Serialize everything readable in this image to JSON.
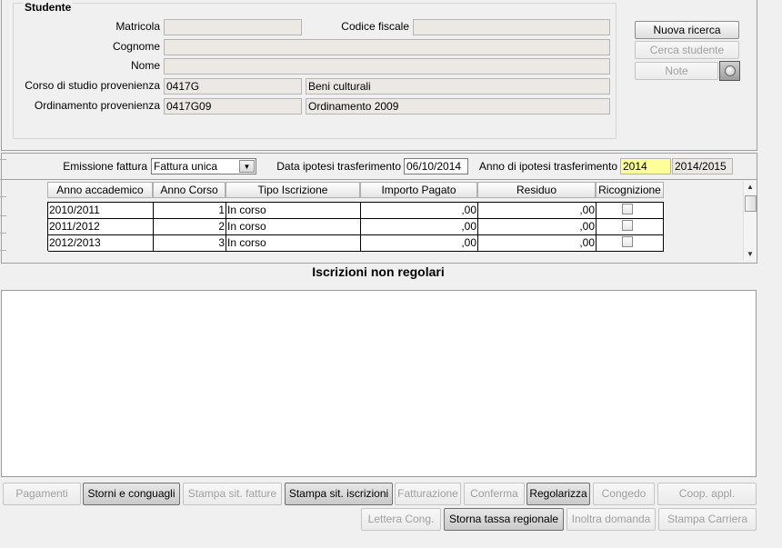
{
  "student_section": {
    "title": "Studente",
    "matricola_label": "Matricola",
    "matricola_value": "",
    "codice_fiscale_label": "Codice fiscale",
    "codice_fiscale_value": "",
    "cognome_label": "Cognome",
    "cognome_value": "",
    "nome_label": "Nome",
    "nome_value": "",
    "corso_label": "Corso di studio provenienza",
    "corso_code": "0417G",
    "corso_name": "Beni culturali",
    "ordinamento_label": "Ordinamento provenienza",
    "ordinamento_code": "0417G09",
    "ordinamento_name": "Ordinamento 2009"
  },
  "side_buttons": {
    "nuova_ricerca": "Nuova ricerca",
    "cerca_studente": "Cerca studente",
    "note": "Note"
  },
  "options_bar": {
    "emissione_label": "Emissione fattura",
    "emissione_value": "Fattura unica",
    "data_label": "Data ipotesi trasferimento",
    "data_value": "06/10/2014",
    "anno_label": "Anno di ipotesi trasferimento",
    "anno_value": "2014",
    "anno_range": "2014/2015",
    "anno_highlight_color": "#ffff99"
  },
  "table": {
    "headers": [
      "Anno accademico",
      "Anno Corso",
      "Tipo Iscrizione",
      "Importo Pagato",
      "Residuo",
      "Ricognizione"
    ],
    "rows": [
      {
        "anno": "2010/2011",
        "corso": "1",
        "tipo": "In corso",
        "importo": ",00",
        "residuo": ",00",
        "ricognizione": false
      },
      {
        "anno": "2011/2012",
        "corso": "2",
        "tipo": "In corso",
        "importo": ",00",
        "residuo": ",00",
        "ricognizione": false
      },
      {
        "anno": "2012/2013",
        "corso": "3",
        "tipo": "In corso",
        "importo": ",00",
        "residuo": ",00",
        "ricognizione": false
      }
    ]
  },
  "irregular_section": {
    "title": "Iscrizioni non regolari",
    "content": ""
  },
  "bottom_buttons": {
    "row1": [
      "Pagamenti",
      "Storni e conguagli",
      "Stampa sit. fatture",
      "Stampa sit. iscrizioni",
      "Fatturazione",
      "Conferma",
      "Regolarizza",
      "Congedo",
      "Coop. appl."
    ],
    "row2": [
      "Lettera Cong.",
      "Storna tassa regionale",
      "Inoltra domanda",
      "Stampa Carriera"
    ]
  }
}
